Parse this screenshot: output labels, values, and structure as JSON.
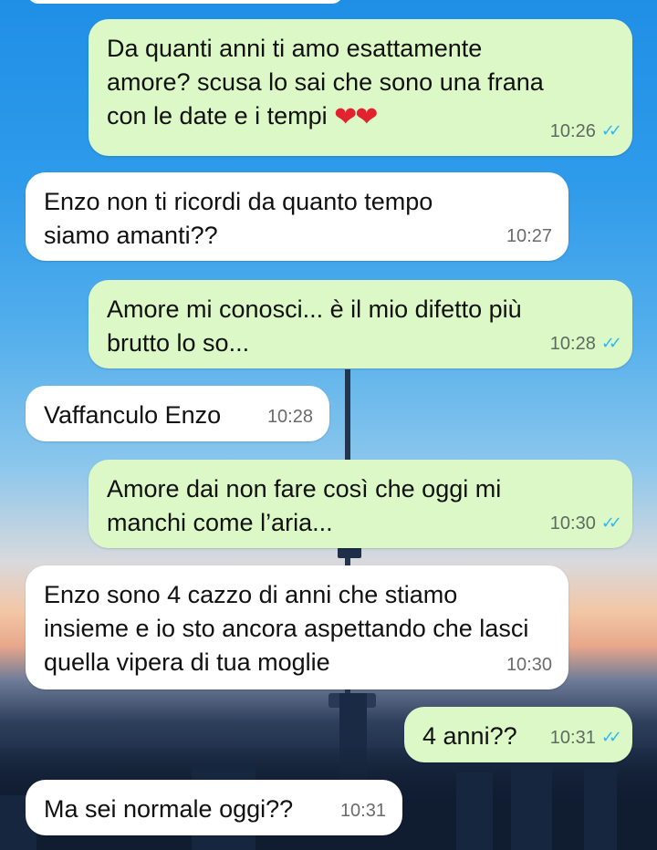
{
  "messages": [
    {
      "dir": "out",
      "text": "Da quanti anni ti amo esattamente amore? scusa lo sai che sono una frana con le date e i tempi",
      "emoji": "❤❤",
      "time": "10:26",
      "ticks": "✓✓"
    },
    {
      "dir": "in",
      "text": "Enzo non ti ricordi da quanto tempo siamo amanti??",
      "time": "10:27"
    },
    {
      "dir": "out",
      "text": "Amore mi conosci... è il mio difetto più brutto lo so...",
      "time": "10:28",
      "ticks": "✓✓"
    },
    {
      "dir": "in",
      "text": "Vaffanculo Enzo",
      "time": "10:28"
    },
    {
      "dir": "out",
      "text": "Amore dai non fare così che oggi mi manchi come l’aria...",
      "time": "10:30",
      "ticks": "✓✓"
    },
    {
      "dir": "in",
      "text": "Enzo sono 4 cazzo di anni che stiamo insieme e io sto ancora aspettando che lasci quella vipera di tua moglie",
      "time": "10:30"
    },
    {
      "dir": "out",
      "text": "4 anni??",
      "time": "10:31",
      "ticks": "✓✓"
    },
    {
      "dir": "in",
      "text": "Ma sei normale oggi??",
      "time": "10:31"
    }
  ],
  "colors": {
    "outgoing": "#dcf8c6",
    "incoming": "#ffffff",
    "read_ticks": "#34b7f1"
  }
}
